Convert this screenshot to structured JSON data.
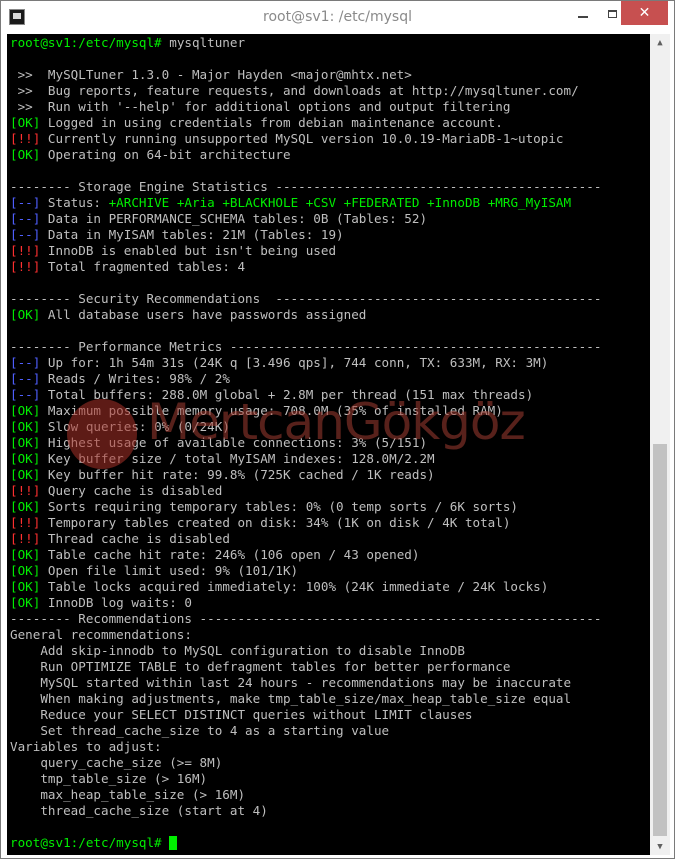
{
  "window": {
    "title": "root@sv1: /etc/mysql",
    "minimize": "–",
    "maximize": "",
    "close": "✕"
  },
  "colors": {
    "ok": "#00ee00",
    "bad": "#ff3030",
    "info": "#5060ff",
    "text": "#bfbfbf",
    "background": "#000000",
    "close_button": "#c75050"
  },
  "terminal": {
    "lines": [
      [
        {
          "t": "root@sv1:/etc/mysql# ",
          "c": "g"
        },
        {
          "t": "mysqltuner"
        }
      ],
      [
        {
          "t": ""
        }
      ],
      [
        {
          "t": " >>  MySQLTuner 1.3.0 - Major Hayden <major@mhtx.net>"
        }
      ],
      [
        {
          "t": " >>  Bug reports, feature requests, and downloads at http://mysqltuner.com/"
        }
      ],
      [
        {
          "t": " >>  Run with '--help' for additional options and output filtering"
        }
      ],
      [
        {
          "t": "[OK]",
          "c": "g"
        },
        {
          "t": " Logged in using credentials from debian maintenance account."
        }
      ],
      [
        {
          "t": "[!!]",
          "c": "r"
        },
        {
          "t": " Currently running unsupported MySQL version 10.0.19-MariaDB-1~utopic"
        }
      ],
      [
        {
          "t": "[OK]",
          "c": "g"
        },
        {
          "t": " Operating on 64-bit architecture"
        }
      ],
      [
        {
          "t": ""
        }
      ],
      [
        {
          "t": "-------- Storage Engine Statistics -------------------------------------------"
        }
      ],
      [
        {
          "t": "[--]",
          "c": "b"
        },
        {
          "t": " Status: "
        },
        {
          "t": "+ARCHIVE +Aria +BLACKHOLE +CSV +FEDERATED +InnoDB +MRG_MyISAM",
          "c": "g"
        }
      ],
      [
        {
          "t": "[--]",
          "c": "b"
        },
        {
          "t": " Data in PERFORMANCE_SCHEMA tables: 0B (Tables: 52)"
        }
      ],
      [
        {
          "t": "[--]",
          "c": "b"
        },
        {
          "t": " Data in MyISAM tables: 21M (Tables: 19)"
        }
      ],
      [
        {
          "t": "[!!]",
          "c": "r"
        },
        {
          "t": " InnoDB is enabled but isn't being used"
        }
      ],
      [
        {
          "t": "[!!]",
          "c": "r"
        },
        {
          "t": " Total fragmented tables: 4"
        }
      ],
      [
        {
          "t": ""
        }
      ],
      [
        {
          "t": "-------- Security Recommendations  -------------------------------------------"
        }
      ],
      [
        {
          "t": "[OK]",
          "c": "g"
        },
        {
          "t": " All database users have passwords assigned"
        }
      ],
      [
        {
          "t": ""
        }
      ],
      [
        {
          "t": "-------- Performance Metrics -------------------------------------------------"
        }
      ],
      [
        {
          "t": "[--]",
          "c": "b"
        },
        {
          "t": " Up for: 1h 54m 31s (24K q [3.496 qps], 744 conn, TX: 633M, RX: 3M)"
        }
      ],
      [
        {
          "t": "[--]",
          "c": "b"
        },
        {
          "t": " Reads / Writes: 98% / 2%"
        }
      ],
      [
        {
          "t": "[--]",
          "c": "b"
        },
        {
          "t": " Total buffers: 288.0M global + 2.8M per thread (151 max threads)"
        }
      ],
      [
        {
          "t": "[OK]",
          "c": "g"
        },
        {
          "t": " Maximum possible memory usage: 708.0M (35% of installed RAM)"
        }
      ],
      [
        {
          "t": "[OK]",
          "c": "g"
        },
        {
          "t": " Slow queries: 0% (0/24K)"
        }
      ],
      [
        {
          "t": "[OK]",
          "c": "g"
        },
        {
          "t": " Highest usage of available connections: 3% (5/151)"
        }
      ],
      [
        {
          "t": "[OK]",
          "c": "g"
        },
        {
          "t": " Key buffer size / total MyISAM indexes: 128.0M/2.2M"
        }
      ],
      [
        {
          "t": "[OK]",
          "c": "g"
        },
        {
          "t": " Key buffer hit rate: 99.8% (725K cached / 1K reads)"
        }
      ],
      [
        {
          "t": "[!!]",
          "c": "r"
        },
        {
          "t": " Query cache is disabled"
        }
      ],
      [
        {
          "t": "[OK]",
          "c": "g"
        },
        {
          "t": " Sorts requiring temporary tables: 0% (0 temp sorts / 6K sorts)"
        }
      ],
      [
        {
          "t": "[!!]",
          "c": "r"
        },
        {
          "t": " Temporary tables created on disk: 34% (1K on disk / 4K total)"
        }
      ],
      [
        {
          "t": "[!!]",
          "c": "r"
        },
        {
          "t": " Thread cache is disabled"
        }
      ],
      [
        {
          "t": "[OK]",
          "c": "g"
        },
        {
          "t": " Table cache hit rate: 246% (106 open / 43 opened)"
        }
      ],
      [
        {
          "t": "[OK]",
          "c": "g"
        },
        {
          "t": " Open file limit used: 9% (101/1K)"
        }
      ],
      [
        {
          "t": "[OK]",
          "c": "g"
        },
        {
          "t": " Table locks acquired immediately: 100% (24K immediate / 24K locks)"
        }
      ],
      [
        {
          "t": "[OK]",
          "c": "g"
        },
        {
          "t": " InnoDB log waits: 0"
        }
      ],
      [
        {
          "t": "-------- Recommendations -----------------------------------------------------"
        }
      ],
      [
        {
          "t": "General recommendations:"
        }
      ],
      [
        {
          "t": "    Add skip-innodb to MySQL configuration to disable InnoDB"
        }
      ],
      [
        {
          "t": "    Run OPTIMIZE TABLE to defragment tables for better performance"
        }
      ],
      [
        {
          "t": "    MySQL started within last 24 hours - recommendations may be inaccurate"
        }
      ],
      [
        {
          "t": "    When making adjustments, make tmp_table_size/max_heap_table_size equal"
        }
      ],
      [
        {
          "t": "    Reduce your SELECT DISTINCT queries without LIMIT clauses"
        }
      ],
      [
        {
          "t": "    Set thread_cache_size to 4 as a starting value"
        }
      ],
      [
        {
          "t": "Variables to adjust:"
        }
      ],
      [
        {
          "t": "    query_cache_size (>= 8M)"
        }
      ],
      [
        {
          "t": "    tmp_table_size (> 16M)"
        }
      ],
      [
        {
          "t": "    max_heap_table_size (> 16M)"
        }
      ],
      [
        {
          "t": "    thread_cache_size (start at 4)"
        }
      ],
      [
        {
          "t": ""
        }
      ],
      [
        {
          "t": "root@sv1:/etc/mysql# ",
          "c": "g"
        },
        {
          "cursor": true
        }
      ]
    ]
  },
  "watermark": {
    "text": "MertcanGökgöz"
  },
  "scrollbar": {
    "up_icon": "▲",
    "down_icon": "▼"
  }
}
